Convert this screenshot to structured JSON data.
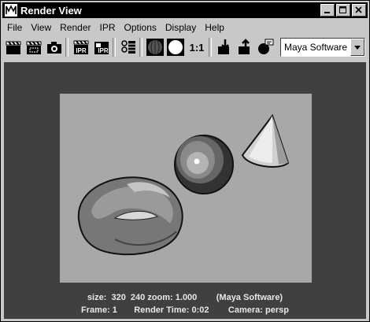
{
  "window": {
    "title": "Render View"
  },
  "menu": [
    "File",
    "View",
    "Render",
    "IPR",
    "Options",
    "Display",
    "Help"
  ],
  "toolbar": {
    "ipr_label": "IPR",
    "ratio_label": "1:1",
    "renderer": "Maya Software"
  },
  "status": {
    "line1": "size:  320  240 zoom: 1.000        (Maya Software)",
    "line2": "Frame: 1       Render Time: 0:02        Camera: persp"
  }
}
